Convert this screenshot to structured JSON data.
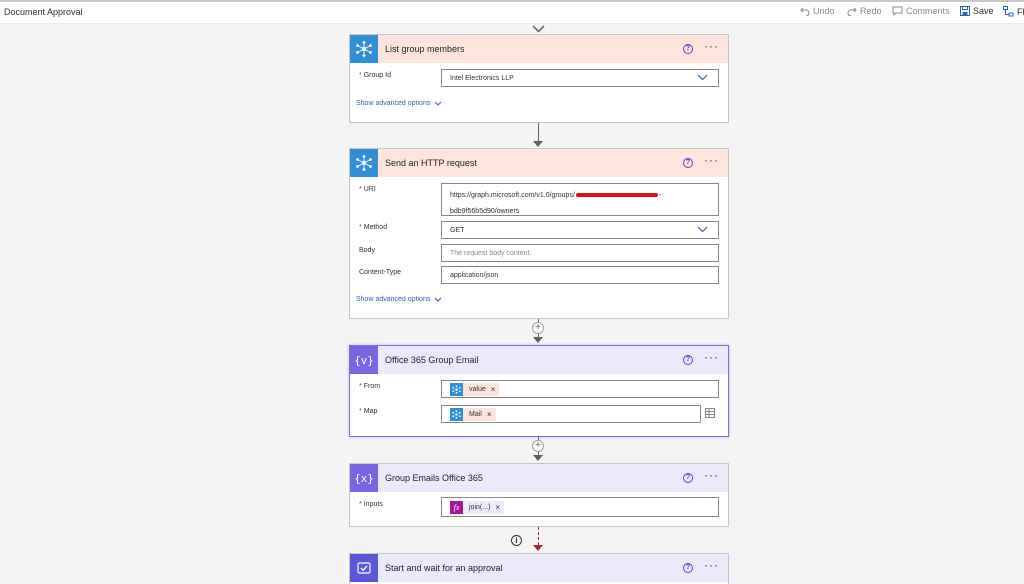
{
  "app": {
    "title": "Document Approval"
  },
  "toolbar": {
    "undo": "Undo",
    "redo": "Redo",
    "comments": "Comments",
    "save": "Save",
    "flow_checker": "Fl"
  },
  "cards": {
    "list_group_members": {
      "title": "List group members",
      "icon": "graph-icon",
      "fields": {
        "group_id_label": "Group Id",
        "group_id_value": "Intel Electronics LLP"
      },
      "advanced": "Show advanced options"
    },
    "http_request": {
      "title": "Send an HTTP request",
      "icon": "graph-icon",
      "fields": {
        "uri_label": "URI",
        "uri_line1": "https://graph.microsoft.com/v1.0/groups/",
        "uri_line1_end": "-",
        "uri_line2": "bdb9f56b5d90/owners",
        "method_label": "Method",
        "method_value": "GET",
        "body_label": "Body",
        "body_placeholder": "The request body content.",
        "content_type_label": "Content-Type",
        "content_type_value": "application/json"
      },
      "advanced": "Show advanced options"
    },
    "group_email": {
      "title": "Office 365 Group Email",
      "icon": "variable-icon",
      "fields": {
        "from_label": "From",
        "from_token": "value",
        "map_label": "Map",
        "map_token": "Mail"
      }
    },
    "group_emails": {
      "title": "Group Emails Office 365",
      "icon": "variable-icon",
      "fields": {
        "inputs_label": "Inputs",
        "inputs_token": "join(...)",
        "fx_label": "fx"
      }
    },
    "approval": {
      "title": "Start and wait for an approval",
      "icon": "approval-icon"
    }
  },
  "colors": {
    "connector_header": "#fde5de",
    "variable_header": "#ece9fb",
    "graph_icon_bg": "#2e8fd6",
    "variable_icon_bg": "#7b64e0",
    "link": "#2b61b8",
    "required": "#a4262c"
  }
}
